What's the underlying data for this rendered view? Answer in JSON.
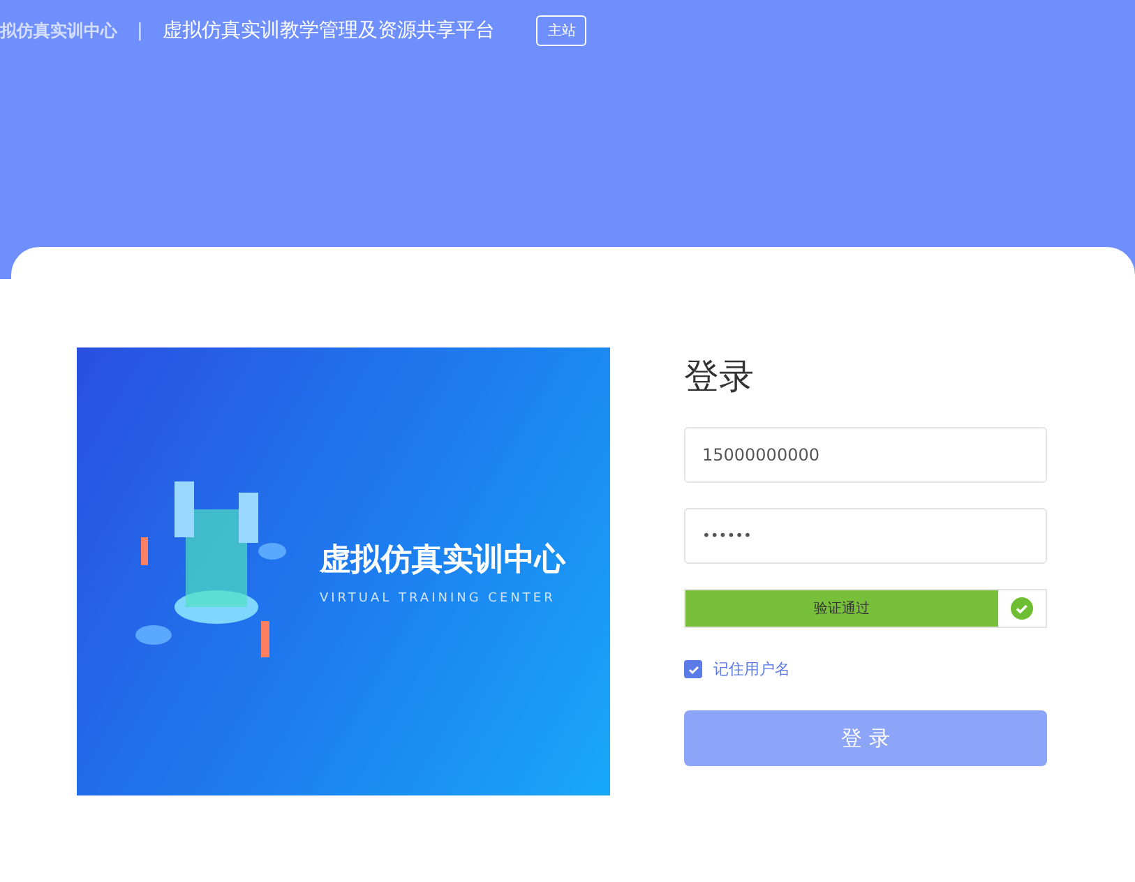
{
  "header": {
    "logo_text": "拟仿真实训中心",
    "separator": "|",
    "platform_title": "虚拟仿真实训教学管理及资源共享平台",
    "main_site_button": "主站"
  },
  "banner": {
    "title": "虚拟仿真实训中心",
    "subtitle": "VIRTUAL TRAINING CENTER"
  },
  "login": {
    "title": "登录",
    "username": {
      "value": "15000000000"
    },
    "password": {
      "value": "••••••"
    },
    "slider": {
      "label": "验证通过",
      "level": 1,
      "verified": true
    },
    "remember": {
      "label": "记住用户名",
      "checked": true
    },
    "submit": "登 录"
  }
}
